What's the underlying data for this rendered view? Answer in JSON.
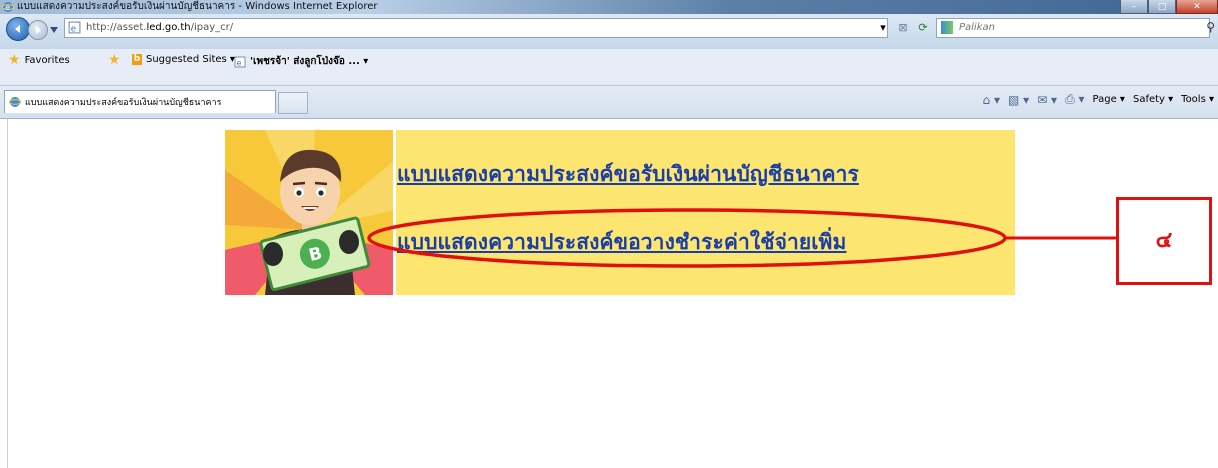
{
  "window": {
    "title": "แบบแสดงความประสงค์ขอรับเงินผ่านบัญชีธนาคาร - Windows Internet Explorer",
    "min": "–",
    "max": "□",
    "close": "✕"
  },
  "address": {
    "url_prefix": "http://asset.",
    "url_domain": "led.go.th",
    "url_path": "/ipay_cr/",
    "search_placeholder": "Palikan"
  },
  "favorites": {
    "label": "Favorites",
    "suggested": "Suggested Sites ▾",
    "item": "'เพชรจ้า' ส่งลูกโป่งจ๊อ ... ▾"
  },
  "tab": {
    "label": "แบบแสดงความประสงค์ขอรับเงินผ่านบัญชีธนาคาร"
  },
  "command_bar": {
    "page": "Page ▾",
    "safety": "Safety ▾",
    "tools": "Tools ▾"
  },
  "page": {
    "link_receive": "แบบแสดงความประสงค์ขอรับเงินผ่านบัญชีธนาคาร",
    "link_pay": "แบบแสดงความประสงค์ขอวางชำระค่าใช้จ่ายเพิ่ม"
  },
  "annotation": {
    "number": "๔",
    "color": "#e01010"
  }
}
